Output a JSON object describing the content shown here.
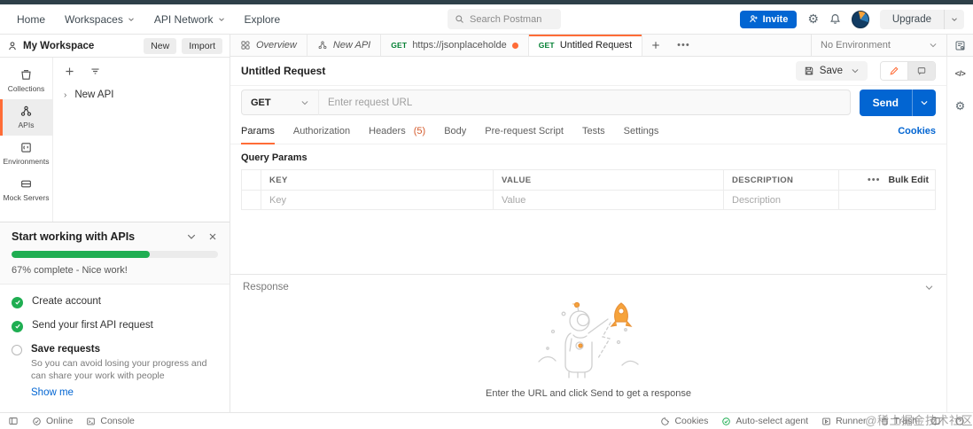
{
  "topnav": {
    "items": [
      "Home",
      "Workspaces",
      "API Network",
      "Explore"
    ],
    "search_placeholder": "Search Postman",
    "invite_label": "Invite",
    "upgrade_label": "Upgrade"
  },
  "sidebar": {
    "workspace_title": "My Workspace",
    "new_button": "New",
    "import_button": "Import",
    "rail": {
      "collections": "Collections",
      "apis": "APIs",
      "environments": "Environments",
      "mock_servers": "Mock Servers"
    },
    "tree_item_label": "New API"
  },
  "onboarding": {
    "title": "Start working with APIs",
    "progress_percent": 67,
    "progress_text": "67% complete - Nice work!",
    "items": [
      {
        "label": "Create account",
        "done": true
      },
      {
        "label": "Send your first API request",
        "done": true
      },
      {
        "label": "Save requests",
        "done": false,
        "description": "So you can avoid losing your progress and can share your work with people",
        "link_label": "Show me"
      }
    ]
  },
  "tabs": {
    "items": [
      {
        "label": "Overview"
      },
      {
        "label": "New API"
      },
      {
        "method": "GET",
        "label": "https://jsonplaceholde",
        "unsaved": true
      },
      {
        "method": "GET",
        "label": "Untitled Request",
        "active": true
      }
    ],
    "environment_selector": "No Environment"
  },
  "request": {
    "title": "Untitled Request",
    "save_label": "Save",
    "method": "GET",
    "url_placeholder": "Enter request URL",
    "send_label": "Send",
    "tabs": [
      {
        "label": "Params",
        "active": true
      },
      {
        "label": "Authorization"
      },
      {
        "label": "Headers",
        "count": "(5)"
      },
      {
        "label": "Body"
      },
      {
        "label": "Pre-request Script"
      },
      {
        "label": "Tests"
      },
      {
        "label": "Settings"
      }
    ],
    "cookies_link": "Cookies",
    "query_params_title": "Query Params",
    "table": {
      "columns": [
        "KEY",
        "VALUE",
        "DESCRIPTION"
      ],
      "bulk_edit_label": "Bulk Edit",
      "placeholder_row": {
        "key": "Key",
        "value": "Value",
        "description": "Description"
      }
    }
  },
  "response": {
    "title": "Response",
    "empty_message": "Enter the URL and click Send to get a response"
  },
  "statusbar": {
    "online": "Online",
    "console": "Console",
    "cookies": "Cookies",
    "agent": "Auto-select agent",
    "runner": "Runner",
    "trash": "Trash"
  },
  "watermark": "@稀土掘金技术社区",
  "colors": {
    "accent": "#ff6c37",
    "blue": "#0265d2",
    "method_get": "#007f31",
    "success_green": "#1fae52"
  }
}
